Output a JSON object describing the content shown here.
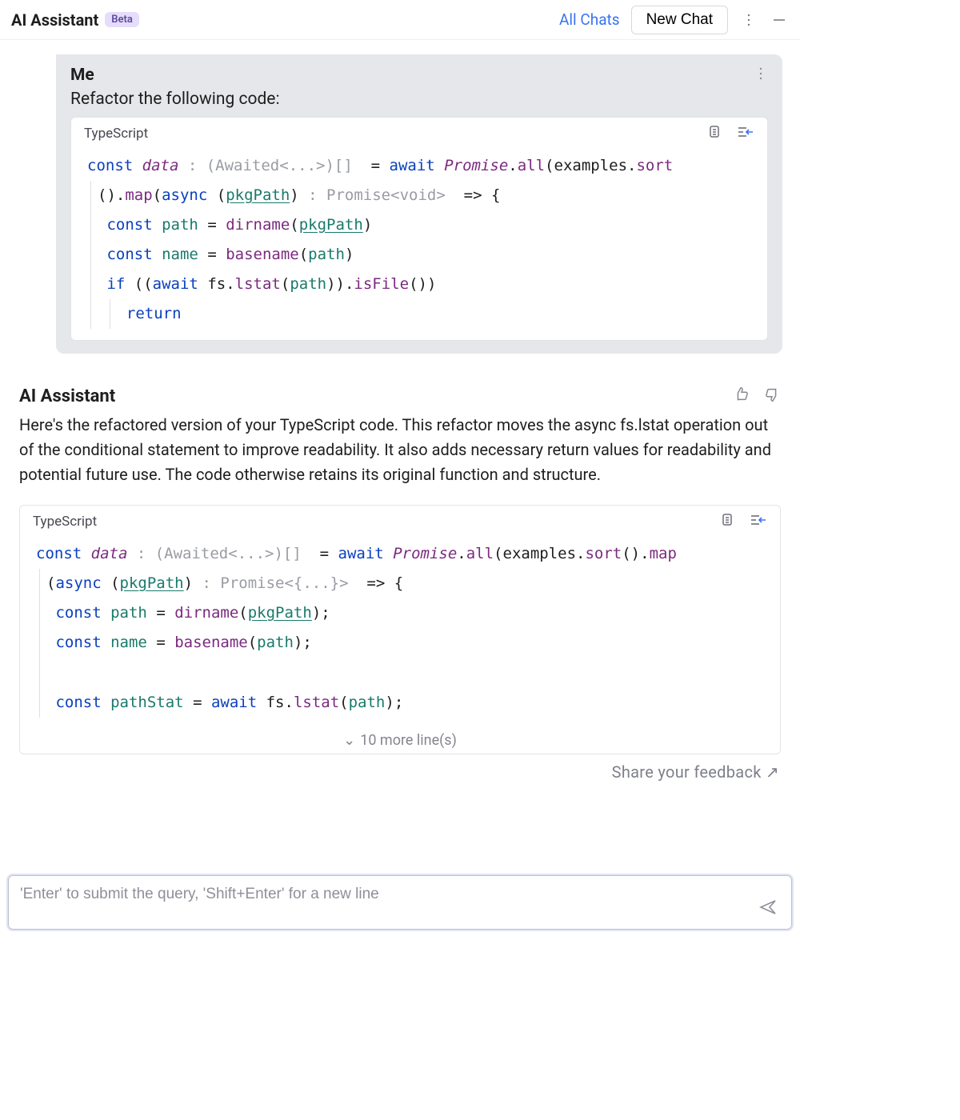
{
  "toolbar": {
    "title": "AI Assistant",
    "badge": "Beta",
    "all_chats": "All Chats",
    "new_chat": "New Chat"
  },
  "user_message": {
    "sender": "Me",
    "prompt": "Refactor the following code:",
    "code": {
      "language": "TypeScript",
      "tokens": {
        "const": "const",
        "data": "data",
        "type1": " : (Awaited<...>)[]  ",
        "eq": "= ",
        "await": "await",
        "promise": "Promise",
        "dot": ".",
        "all": "all",
        "lp": "(",
        "examples": "examples",
        "sort": "sort",
        "map": "map",
        "async": "async",
        "pkgPath": "pkgPath",
        "sig2": " : Promise<void>  ",
        "arrow": "=> {",
        "path": "path",
        "dirname": "dirname",
        "name": "name",
        "basename": "basename",
        "if": "if",
        "fs": "fs",
        "lstat": "lstat",
        "isFile": "isFile",
        "return": "return"
      }
    }
  },
  "assistant_message": {
    "sender": "AI Assistant",
    "text": "Here's the refactored version of your TypeScript code. This refactor moves the async fs.lstat operation out of the conditional statement to improve readability. It also adds necessary return values for readability and potential future use. The code otherwise retains its original function and structure.",
    "code": {
      "language": "TypeScript",
      "more_lines": "10 more line(s)",
      "tokens": {
        "const": "const",
        "data": "data",
        "type1": " : (Awaited<...>)[]  ",
        "await": "await",
        "promise": "Promise",
        "all": "all",
        "examples": "examples",
        "sort": "sort",
        "map": "map",
        "async": "async",
        "pkgPath": "pkgPath",
        "sig2": " : Promise<{...}>  ",
        "arrow": "=> {",
        "path": "path",
        "dirname": "dirname",
        "name": "name",
        "basename": "basename",
        "pathStat": "pathStat",
        "fs": "fs",
        "lstat": "lstat"
      }
    }
  },
  "feedback_link": "Share your feedback ↗",
  "input_placeholder": "'Enter' to submit the query, 'Shift+Enter' for a new line"
}
